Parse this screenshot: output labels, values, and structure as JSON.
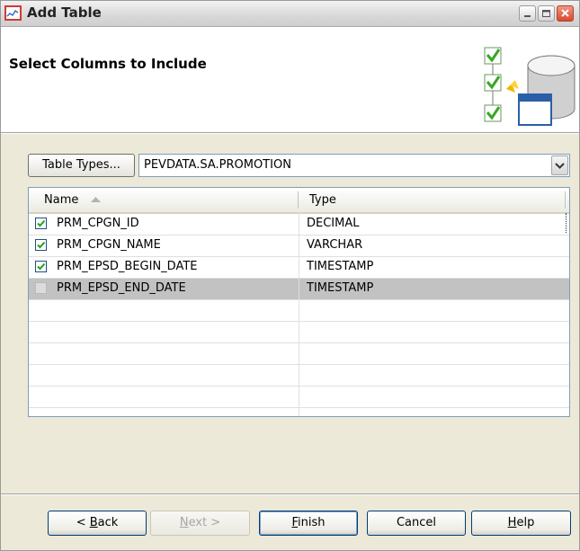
{
  "window": {
    "title": "Add Table",
    "minimize_icon": "minimize-icon",
    "maximize_icon": "maximize-icon",
    "close_icon": "close-icon"
  },
  "banner": {
    "title": "Select Columns to Include",
    "icon": "database-columns-icon"
  },
  "toolbar": {
    "table_types_label": "Table Types...",
    "table_select_value": "PEVDATA.SA.PROMOTION"
  },
  "grid": {
    "columns": [
      "Name",
      "Type"
    ],
    "sort_column": "Name",
    "sort_direction": "ascending",
    "rows": [
      {
        "checked": true,
        "name": "PRM_CPGN_ID",
        "type": "DECIMAL",
        "selected": false
      },
      {
        "checked": true,
        "name": "PRM_CPGN_NAME",
        "type": "VARCHAR",
        "selected": false
      },
      {
        "checked": true,
        "name": "PRM_EPSD_BEGIN_DATE",
        "type": "TIMESTAMP",
        "selected": false
      },
      {
        "checked": false,
        "name": "PRM_EPSD_END_DATE",
        "type": "TIMESTAMP",
        "selected": true
      }
    ],
    "empty_rows": 5
  },
  "footer": {
    "back_prefix": "<",
    "back_mnemonic": "B",
    "back_rest": "ack",
    "next_mnemonic": "N",
    "next_rest": "ext >",
    "finish_mnemonic": "F",
    "finish_rest": "inish",
    "cancel_label": "Cancel",
    "help_mnemonic": "H",
    "help_rest": "elp"
  },
  "colors": {
    "selected_row": "#c2c2c2",
    "check_mark": "#21a121",
    "close_button": "#d74a2c"
  }
}
